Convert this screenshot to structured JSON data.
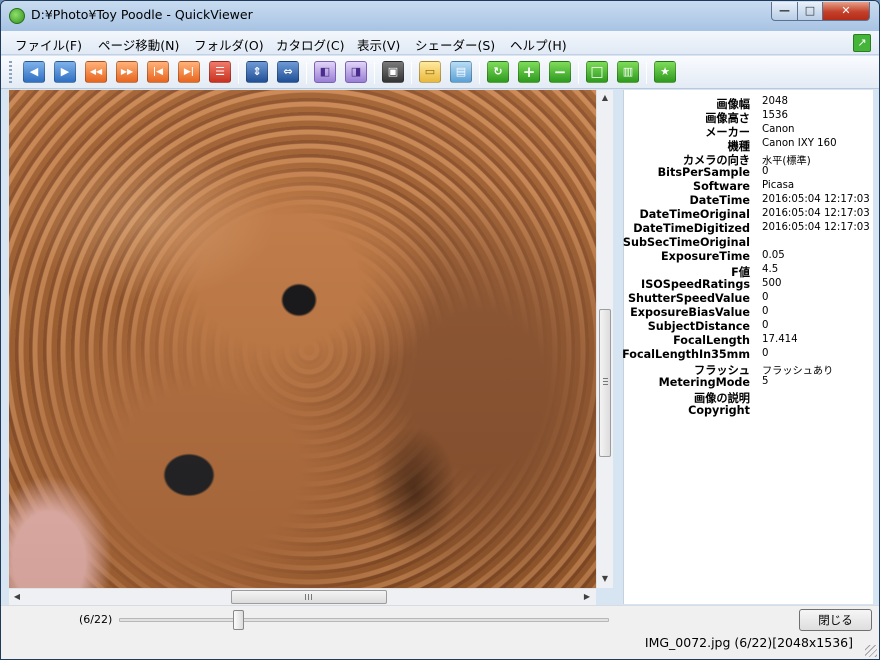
{
  "window": {
    "title": "D:¥Photo¥Toy Poodle - QuickViewer",
    "minimize_label": "—",
    "maximize_label": "□",
    "close_label": "✕"
  },
  "menu": {
    "items": [
      "ファイル(F)",
      "ページ移動(N)",
      "フォルダ(O)",
      "カタログ(C)",
      "表示(V)",
      "シェーダー(S)",
      "ヘルプ(H)"
    ]
  },
  "toolbar": {
    "buttons": [
      {
        "icon": "prev-page-icon",
        "glyph": "◀"
      },
      {
        "icon": "next-page-icon",
        "glyph": "▶"
      },
      {
        "icon": "rewind-icon",
        "glyph": "◀◀"
      },
      {
        "icon": "fast-forward-icon",
        "glyph": "▶▶"
      },
      {
        "icon": "first-page-icon",
        "glyph": "|◀"
      },
      {
        "icon": "last-page-icon",
        "glyph": "▶|"
      },
      {
        "icon": "list-icon",
        "glyph": "☰"
      },
      {
        "icon": "fit-page-icon",
        "glyph": "⇕"
      },
      {
        "icon": "fit-window-icon",
        "glyph": "⇔"
      },
      {
        "icon": "spread-left-icon",
        "glyph": "◧"
      },
      {
        "icon": "spread-right-icon",
        "glyph": "◨"
      },
      {
        "icon": "slideshow-icon",
        "glyph": "▣"
      },
      {
        "icon": "open-folder-icon",
        "glyph": "▭"
      },
      {
        "icon": "catalog-icon",
        "glyph": "▤"
      },
      {
        "icon": "rotate-icon",
        "glyph": "↻"
      },
      {
        "icon": "zoom-in-icon",
        "glyph": "+"
      },
      {
        "icon": "zoom-out-icon",
        "glyph": "−"
      },
      {
        "icon": "fullscreen-icon",
        "glyph": "□"
      },
      {
        "icon": "book-icon",
        "glyph": "▥"
      },
      {
        "icon": "pin-icon",
        "glyph": "★"
      }
    ]
  },
  "exif": [
    {
      "key": "画像幅",
      "value": "2048"
    },
    {
      "key": "画像高さ",
      "value": "1536"
    },
    {
      "key": "メーカー",
      "value": "Canon"
    },
    {
      "key": "機種",
      "value": "Canon IXY 160"
    },
    {
      "key": "カメラの向き",
      "value": "水平(標準)"
    },
    {
      "key": "BitsPerSample",
      "value": "0"
    },
    {
      "key": "Software",
      "value": "Picasa"
    },
    {
      "key": "DateTime",
      "value": "2016:05:04  12:17:03"
    },
    {
      "key": "DateTimeOriginal",
      "value": "2016:05:04  12:17:03"
    },
    {
      "key": "DateTimeDigitized",
      "value": "2016:05:04  12:17:03"
    },
    {
      "key": "SubSecTimeOriginal",
      "value": ""
    },
    {
      "key": "ExposureTime",
      "value": "0.05"
    },
    {
      "key": "F値",
      "value": "4.5"
    },
    {
      "key": "ISOSpeedRatings",
      "value": "500"
    },
    {
      "key": "ShutterSpeedValue",
      "value": "0"
    },
    {
      "key": "ExposureBiasValue",
      "value": "0"
    },
    {
      "key": "SubjectDistance",
      "value": "0"
    },
    {
      "key": "FocalLength",
      "value": "17.414"
    },
    {
      "key": "FocalLengthIn35mm",
      "value": "0"
    },
    {
      "key": "フラッシュ",
      "value": "フラッシュあり"
    },
    {
      "key": "MeteringMode",
      "value": "5"
    },
    {
      "key": "画像の説明",
      "value": ""
    },
    {
      "key": "Copyright",
      "value": ""
    }
  ],
  "bottom": {
    "page_indicator": "(6/22)",
    "page_progress": 0.2381,
    "close_button": "閉じる",
    "status": "IMG_0072.jpg (6/22)[2048x1536]"
  },
  "scrollbars": {
    "up_arrow": "▲",
    "down_arrow": "▼",
    "left_arrow": "◀",
    "right_arrow": "▶"
  }
}
